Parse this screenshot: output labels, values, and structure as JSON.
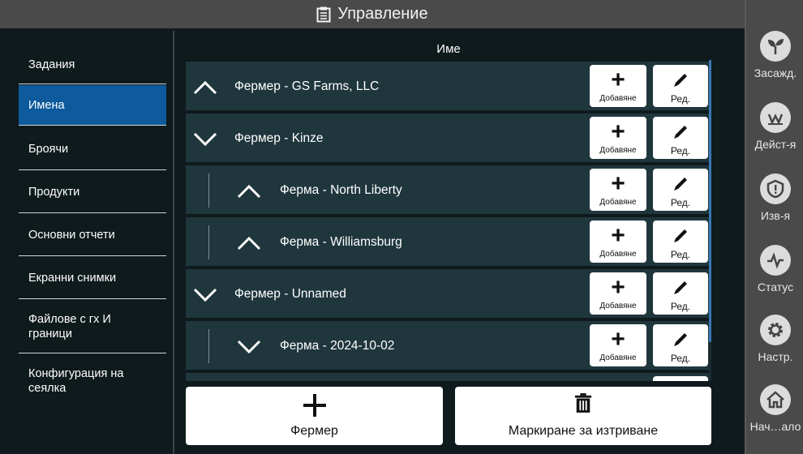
{
  "title": {
    "text": "Управление",
    "icon": "clipboard-icon"
  },
  "left_menu": {
    "items": [
      {
        "label": "Задания",
        "active": false
      },
      {
        "label": "Имена",
        "active": true
      },
      {
        "label": "Броячи",
        "active": false
      },
      {
        "label": "Продукти",
        "active": false
      },
      {
        "label": "Основни отчети",
        "active": false
      },
      {
        "label": "Екранни снимки",
        "active": false
      },
      {
        "label": "Файлове с гх И граници",
        "active": false
      },
      {
        "label": "Конфигурация на сеялка",
        "active": false
      }
    ]
  },
  "list": {
    "column_header": "Име",
    "add_label": "Добавяне",
    "edit_label": "Ред.",
    "rows": [
      {
        "label": "Фермер - GS Farms, LLC",
        "expanded": false,
        "level": 0
      },
      {
        "label": "Фермер - Kinze",
        "expanded": true,
        "level": 0
      },
      {
        "label": "Ферма - North Liberty",
        "expanded": false,
        "level": 1
      },
      {
        "label": "Ферма - Williamsburg",
        "expanded": false,
        "level": 1
      },
      {
        "label": "Фермер - Unnamed",
        "expanded": true,
        "level": 0
      },
      {
        "label": "Ферма - 2024-10-02",
        "expanded": true,
        "level": 1
      }
    ]
  },
  "bottom_buttons": {
    "add_farmer": "Фермер",
    "mark_delete": "Маркиране за изтриване"
  },
  "right_nav": {
    "items": [
      {
        "label": "Засажд.",
        "icon": "seedling-icon"
      },
      {
        "label": "Дейст-я",
        "icon": "implement-icon"
      },
      {
        "label": "Изв-я",
        "icon": "shield-alert-icon"
      },
      {
        "label": "Статус",
        "icon": "pulse-icon"
      },
      {
        "label": "Настр.",
        "icon": "gear-icon"
      },
      {
        "label": "Нач…ало",
        "icon": "home-icon"
      }
    ]
  },
  "colors": {
    "accent": "#0d5a9c",
    "row_bg": "#1f363c",
    "bar_bg": "#4a4a4a",
    "bg": "#0f1a1c"
  }
}
